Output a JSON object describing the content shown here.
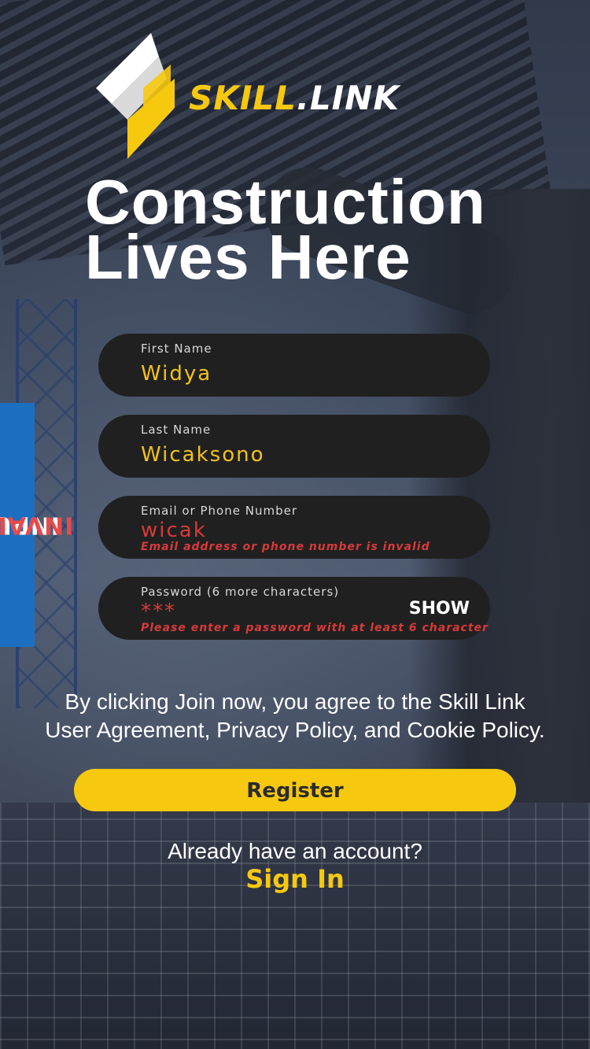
{
  "brand": {
    "logo_part1": "SKILL",
    "logo_part2": ".LINK",
    "accent_color": "#f6c90e",
    "icon": "skill-link-logo-icon"
  },
  "headline": {
    "line1": "Construction",
    "line2": "Lives Here"
  },
  "form": {
    "first_name": {
      "label": "First Name",
      "value": "Widya"
    },
    "last_name": {
      "label": "Last Name",
      "value": "Wicaksono"
    },
    "email": {
      "label": "Email or Phone Number",
      "value": "wicak",
      "error": "Email address or phone number is invalid"
    },
    "password": {
      "label": "Password (6 more characters)",
      "value": "***",
      "toggle_label": "SHOW",
      "error": "Please enter a password with at least 6 character"
    }
  },
  "side_tab": {
    "word1": "INPUT",
    "word2": "INVALID",
    "color": "#1c6fc0"
  },
  "terms": {
    "line1": "By clicking Join now, you agree to the Skill Link",
    "line2": "User Agreement, Privacy Policy, and Cookie Policy."
  },
  "register_label": "Register",
  "footer": {
    "prompt": "Already have an account?",
    "sign_in_label": "Sign In"
  },
  "colors": {
    "error": "#d83a3a",
    "field_bg": "#202020"
  }
}
